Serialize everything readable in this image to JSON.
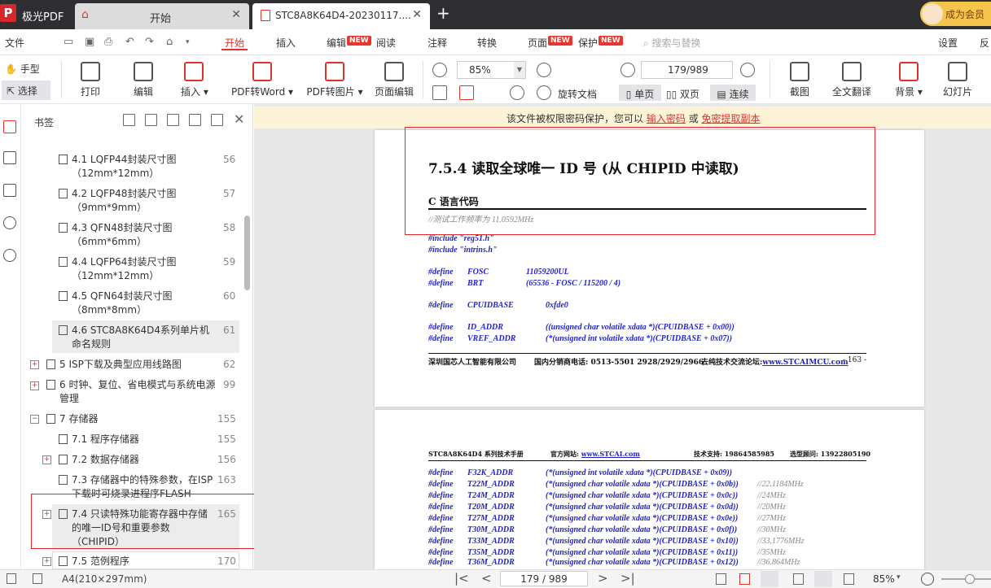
{
  "app": {
    "name": "极光PDF",
    "logo": "P"
  },
  "tabs": [
    {
      "label": "开始"
    },
    {
      "label": "STC8A8K64D4-20230117...."
    }
  ],
  "vip": {
    "label": "成为会员"
  },
  "menu": {
    "file": "文件",
    "start": "开始",
    "insert": "插入",
    "edit": "编辑",
    "read": "阅读",
    "annotate": "注释",
    "convert": "转换",
    "page": "页面",
    "protect": "保护",
    "search": "搜索与替换",
    "settings": "设置",
    "more": "反",
    "new_badge": "NEW"
  },
  "toolbar": {
    "hand": "手型",
    "select": "选择",
    "print": "打印",
    "edit": "编辑",
    "insert": "插入",
    "pdf2word": "PDF转Word",
    "pdf2img": "PDF转图片",
    "pageedit": "页面编辑",
    "zoom": "85%",
    "page": "179/989",
    "rotate": "旋转文档",
    "single": "单页",
    "double": "双页",
    "continuous": "连续",
    "screenshot": "截图",
    "translate": "全文翻译",
    "background": "背景",
    "slideshow": "幻灯片"
  },
  "panel": {
    "title": "书签",
    "items": [
      {
        "title": "4.1 LQFP44封装尺寸图（12mm*12mm）",
        "page": "56"
      },
      {
        "title": "4.2 LQFP48封装尺寸图（9mm*9mm）",
        "page": "57"
      },
      {
        "title": "4.3 QFN48封装尺寸图（6mm*6mm）",
        "page": "58"
      },
      {
        "title": "4.4 LQFP64封装尺寸图（12mm*12mm）",
        "page": "59"
      },
      {
        "title": "4.5 QFN64封装尺寸图（8mm*8mm）",
        "page": "60"
      },
      {
        "title": "4.6 STC8A8K64D4系列单片机命名规则",
        "page": "61"
      },
      {
        "title": "5 ISP下载及典型应用线路图",
        "page": "62"
      },
      {
        "title": "6 时钟、复位、省电模式与系统电源管理",
        "page": "99"
      },
      {
        "title": "7 存储器",
        "page": "155"
      },
      {
        "title": "7.1 程序存储器",
        "page": "155"
      },
      {
        "title": "7.2 数据存储器",
        "page": "156"
      },
      {
        "title": "7.3 存储器中的特殊参数，在ISP下载时可烧录进程序FLASH",
        "page": "163"
      },
      {
        "title": "7.4 只读特殊功能寄存器中存储的唯一ID号和重要参数（CHIPID）",
        "page": "165"
      },
      {
        "title": "7.5 范例程序",
        "page": "170"
      }
    ]
  },
  "notice": {
    "prefix": "该文件被权限密码保护，您可以",
    "link1": "输入密码",
    "mid": "或",
    "link2": "免密提取副本"
  },
  "doc": {
    "page1": {
      "heading": "7.5.4    读取全球唯一 ID 号 (从 CHIPID 中读取)",
      "subheading": "C 语言代码",
      "comment": "//测试工作频率为 11.0592MHz",
      "code": [
        [
          "#include \"reg51.h\"",
          "",
          ""
        ],
        [
          "#include \"intrins.h\"",
          "",
          ""
        ],
        [
          "#define",
          "FOSC",
          "11059200UL"
        ],
        [
          "#define",
          "BRT",
          "(65536 - FOSC / 115200 / 4)"
        ],
        [
          "#define",
          "CPUIDBASE",
          "0xfde0"
        ],
        [
          "#define",
          "ID_ADDR",
          "((unsigned char volatile xdata *)(CPUIDBASE + 0x00))"
        ],
        [
          "#define",
          "VREF_ADDR",
          "(*(unsigned int volatile xdata *)(CPUIDBASE + 0x07))"
        ]
      ],
      "footer": {
        "company": "深圳国芯人工智能有限公司",
        "phone": "国内分销商电话: 0513-5501 2928/2929/2966",
        "forum_label": "去纯技术交流论坛:",
        "forum_url": "www.STCAIMCU.com",
        "pageno": "- 163 -"
      }
    },
    "page2": {
      "header": {
        "manual": "STC8A8K64D4 系列技术手册",
        "site_label": "官方网站:",
        "site_url": "www.STCAI.com",
        "support": "技术支持: 19864585985",
        "selection": "选型顾问: 13922805190"
      },
      "code": [
        [
          "#define",
          "F32K_ADDR",
          "(*(unsigned int volatile xdata *)(CPUIDBASE + 0x09))",
          ""
        ],
        [
          "#define",
          "T22M_ADDR",
          "(*(unsigned char volatile xdata *)(CPUIDBASE + 0x0b))",
          "//22.1184MHz"
        ],
        [
          "#define",
          "T24M_ADDR",
          "(*(unsigned char volatile xdata *)(CPUIDBASE + 0x0c))",
          "//24MHz"
        ],
        [
          "#define",
          "T20M_ADDR",
          "(*(unsigned char volatile xdata *)(CPUIDBASE + 0x0d))",
          "//20MHz"
        ],
        [
          "#define",
          "T27M_ADDR",
          "(*(unsigned char volatile xdata *)(CPUIDBASE + 0x0e))",
          "//27MHz"
        ],
        [
          "#define",
          "T30M_ADDR",
          "(*(unsigned char volatile xdata *)(CPUIDBASE + 0x0f))",
          "//30MHz"
        ],
        [
          "#define",
          "T33M_ADDR",
          "(*(unsigned char volatile xdata *)(CPUIDBASE + 0x10))",
          "//33.1776MHz"
        ],
        [
          "#define",
          "T35M_ADDR",
          "(*(unsigned char volatile xdata *)(CPUIDBASE + 0x11))",
          "//35MHz"
        ],
        [
          "#define",
          "T36M_ADDR",
          "(*(unsigned char volatile xdata *)(CPUIDBASE + 0x12))",
          "//36.864MHz"
        ]
      ]
    }
  },
  "status": {
    "paper": "A4(210×297mm)",
    "page": "179 / 989",
    "zoom": "85%"
  },
  "colors": {
    "accent": "#e0322c",
    "titlebar": "#2f2f33",
    "code": "#2323c8",
    "highlight": "#e3262a"
  }
}
